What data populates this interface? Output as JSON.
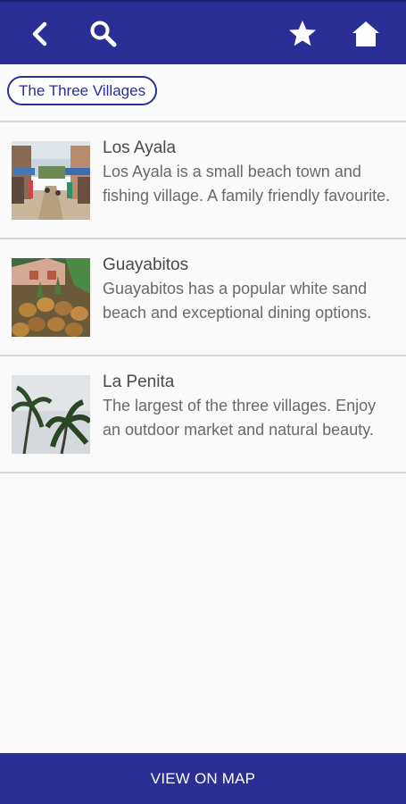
{
  "app": {
    "colors": {
      "primary": "#2b2e94",
      "background": "#fafafa",
      "divider": "#d7d7d7",
      "title_text": "#4a4a4a",
      "body_text": "#6a6a6a"
    }
  },
  "toolbar": {
    "icons": [
      "back-icon",
      "search-icon",
      "star-icon",
      "home-icon"
    ]
  },
  "filter": {
    "chip_label": "The Three Villages"
  },
  "villages": [
    {
      "title": "Los Ayala",
      "description": "Los Ayala is a small beach town and fishing village. A family friendly favourite.",
      "image": "street-market-photo"
    },
    {
      "title": "Guayabitos",
      "description": "Guayabitos has a popular white sand beach and exceptional dining options.",
      "image": "pineapples-photo"
    },
    {
      "title": "La Penita",
      "description": "The largest of the three villages. Enjoy an outdoor market and natural beauty.",
      "image": "palm-trees-photo"
    }
  ],
  "footer": {
    "button_label": "VIEW ON MAP"
  }
}
